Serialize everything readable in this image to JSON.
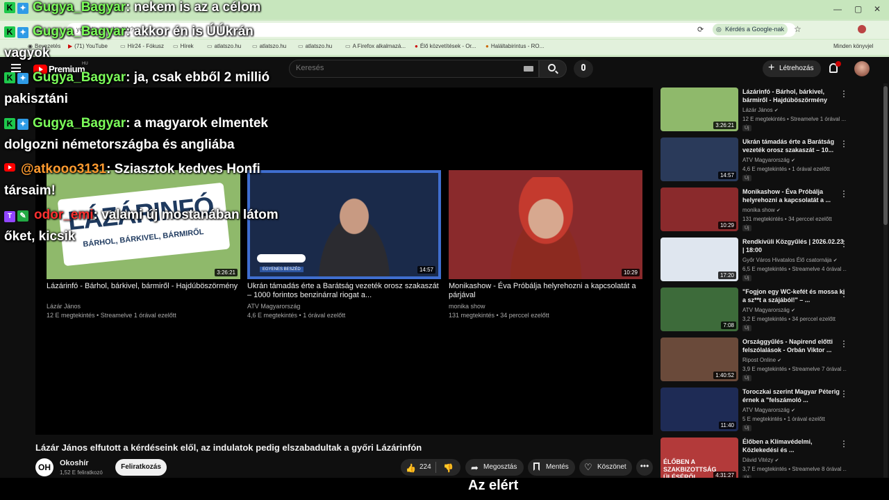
{
  "browser": {
    "url": "youtube.com/watch?v=...",
    "ask_google": "Kérdés a Google-nak",
    "bookmarks": [
      "Bevezetés",
      "(71) YouTube",
      "Hír24 - Fókusz",
      "Hírek",
      "atlatszo.hu",
      "atlatszo.hu",
      "atlatszo.hu",
      "A Firefox alkalmazá...",
      "Élő közvetítések - Or...",
      "Haláltabirintus - RO..."
    ],
    "other_bookmarks": "Minden könyvjel"
  },
  "header": {
    "premium": "Premium",
    "country": "HU",
    "search_placeholder": "Keresés",
    "create_label": "Létrehozás"
  },
  "end_cards": [
    {
      "title": "Lázárinfó - Bárhol, bárkivel, bármiről - Hajdúböszörmény",
      "channel": "Lázár János",
      "meta": "12 E megtekintés • Streamelve 1 órával ezelőtt",
      "duration": "3:26:21",
      "badge_title": "LÁZÁRINFÓ",
      "badge_sub": "BÁRHOL, BÁRKIVEL, BÁRMIRŐL"
    },
    {
      "title": "Ukrán támadás érte a Barátság vezeték orosz szakaszát – 1000 forintos benzinárral riogat a...",
      "channel": "ATV Magyarország",
      "meta": "4,6 E megtekintés • 1 órával ezelőtt",
      "duration": "14:57",
      "badge_label": "EGYENES BESZÉD"
    },
    {
      "title": "Monikashow - Éva Próbálja helyrehozni a kapcsolatát a párjával",
      "channel": "monika show",
      "meta": "131 megtekintés • 34 perccel ezelőtt",
      "duration": "10:29"
    }
  ],
  "video": {
    "title": "Lázár János elfutott a kérdéseink elől, az indulatok pedig elszabadultak a győri Lázárinfón",
    "channel": "Okoshír",
    "channel_initials": "OH",
    "subscribers": "1,52 E feliratkozó",
    "subscribe": "Feliratkozás",
    "likes": "224",
    "share": "Megosztás",
    "save": "Mentés",
    "thanks": "Köszönet",
    "more": "•••"
  },
  "recommendations": [
    {
      "title": "Lázárinfó - Bárhol, bárkivel, bármiről - Hajdúböszörmény",
      "channel": "Lázár János",
      "meta": "12 E megtekintés • Streamelve 1 órával ...",
      "duration": "3:26:21",
      "new": "Új",
      "color": "#8fb96b"
    },
    {
      "title": "Ukrán támadás érte a Barátság vezeték orosz szakaszát – 10...",
      "channel": "ATV Magyarország",
      "meta": "4,6 E megtekintés • 1 órával ezelőtt",
      "duration": "14:57",
      "new": "Új",
      "color": "#2a3a5a"
    },
    {
      "title": "Monikashow - Éva Próbálja helyrehozni a kapcsolatát a ...",
      "channel": "monika show",
      "meta": "131 megtekintés • 34 perccel ezelőtt",
      "duration": "10:29",
      "new": "Új",
      "color": "#8a2a2c"
    },
    {
      "title": "Rendkívüli Közgyűlés | 2026.02.23 | 18:00",
      "channel": "Győr Város Hivatalos Élő csatornája",
      "meta": "6,5 E megtekintés • Streamelve 4 órával ...",
      "duration": "17:20",
      "new": "Új",
      "color": "#dfe6ef"
    },
    {
      "title": "\"Fogjon egy WC-kefét és mossa ki a sz**t a szájából!\" – ...",
      "channel": "ATV Magyarország",
      "meta": "3,2 E megtekintés • 34 perccel ezelőtt",
      "duration": "7:08",
      "new": "Új",
      "color": "#3d6b3a"
    },
    {
      "title": "Országgyűlés - Napirend előtti felszólalások - Orbán Viktor ...",
      "channel": "Ripost Online",
      "meta": "3,9 E megtekintés • Streamelve 7 órával ...",
      "duration": "1:40:52",
      "new": "Új",
      "color": "#6a4a3a"
    },
    {
      "title": "Toroczkai szerint Magyar Péterig érnek a \"felszámoló ...",
      "channel": "ATV Magyarország",
      "meta": "5 E megtekintés • 1 órával ezelőtt",
      "duration": "11:40",
      "new": "Új",
      "color": "#1e2b55"
    },
    {
      "title": "Élőben a Klímavédelmi, Közlekedési és ...",
      "channel": "Dávid Vitézy",
      "meta": "3,7 E megtekintés • Streamelve 8 órával ...",
      "duration": "4:31:27",
      "new": "Új",
      "color": "#b33a3a",
      "overlay": "ÉLŐBEN A SZAKBIZOTTSÁG ÜLÉSÉRŐL"
    }
  ],
  "chat": [
    {
      "user": "Gugya_Bagyar",
      "text": ": nekem is az a célom"
    },
    {
      "user": "Gugya_Bagyar",
      "text": ": akkor én is ÚÚkrán",
      "cont": "vagyok"
    },
    {
      "user": "Gugya_Bagyar",
      "text": ": ja, csak ebből 2 millió",
      "cont": "pakisztáni"
    },
    {
      "user": "Gugya_Bagyar",
      "text": ": a magyarok elmentek",
      "cont": "dolgozni németországba és angliába"
    },
    {
      "user": "@atkooo3131",
      "text": ": Sziasztok kedves Honfi",
      "cont": "társaim!"
    },
    {
      "user": "odor_emi",
      "text": ": valami új mostanában látom",
      "cont": "őket, kicsik"
    }
  ],
  "caption": "Az elért"
}
